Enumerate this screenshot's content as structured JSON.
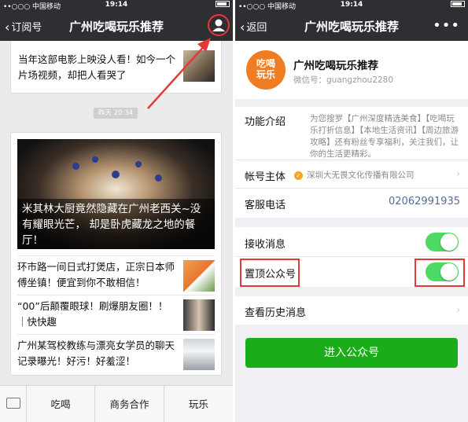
{
  "left": {
    "status": {
      "carrier": "••○○○ 中国移动 ",
      "time": "19:14"
    },
    "nav": {
      "back_label": "订阅号",
      "title": "广州吃喝玩乐推荐"
    },
    "top_card_text": "当年这部电影上映没人看！如今一个片场视频，却把人看哭了",
    "date_label": "昨天 20:34",
    "hero_title": "米其林大厨竟然隐藏在广州老西关~没有耀眼光芒， 却是卧虎藏龙之地的餐厅！",
    "items": [
      {
        "text": "环市路一间日式打煲店，正宗日本师傅坐镇！便宜到你不敢相信！"
      },
      {
        "text": "“00”后颠覆眼球！刷爆朋友圈！！ ｜快快趣"
      },
      {
        "text": "广州某驾校教练与漂亮女学员的聊天记录曝光！好污！好羞涩！"
      }
    ],
    "tabs": [
      "吃喝",
      "商务合作",
      "玩乐"
    ]
  },
  "right": {
    "status": {
      "carrier": "••○○○ 中国移动 ",
      "time": "19:14"
    },
    "nav": {
      "back_label": "返回",
      "title": "广州吃喝玩乐推荐",
      "more": "•••"
    },
    "profile": {
      "logo_text": "吃喝玩乐",
      "name": "广州吃喝玩乐推荐",
      "wechat_id": "微信号：guangzhou2280"
    },
    "intro_label": "功能介绍",
    "intro_text": "为您搜罗【广州深度精选美食】【吃喝玩乐打折信息】【本地生活资讯】【周边旅游攻略】还有粉丝专享福利，关注我们，让你的生活更精彩。",
    "account_label": "帐号主体",
    "account_value": "深圳大无畏文化传播有限公司",
    "phone_label": "客服电话",
    "phone_value": "02062991935",
    "receive_label": "接收消息",
    "receive_on": true,
    "pin_label": "置顶公众号",
    "pin_on": true,
    "history_label": "查看历史消息",
    "enter_button": "进入公众号"
  },
  "colors": {
    "navbar": "#2f2e33",
    "accent_green": "#1aad19",
    "toggle_on": "#4cd964",
    "highlight_red": "#e53935",
    "link_blue": "#576b95",
    "logo_orange": "#f07c24"
  }
}
